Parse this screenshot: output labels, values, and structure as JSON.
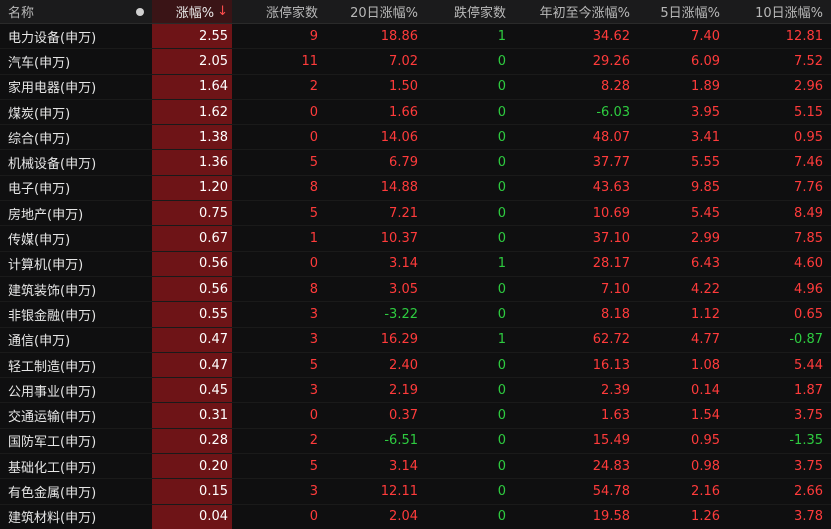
{
  "header": {
    "name": "名称",
    "change": "涨幅%",
    "limit_up": "涨停家数",
    "change_20d": "20日涨幅%",
    "limit_down": "跌停家数",
    "ytd": "年初至今涨幅%",
    "change_5d": "5日涨幅%",
    "change_10d": "10日涨幅%"
  },
  "colors": {
    "up": "#ff3b3b",
    "down": "#2ecc40",
    "highlight": "#6e1417"
  },
  "rows": [
    {
      "name": "电力设备(申万)",
      "change": "2.55",
      "limit_up": "9",
      "change_20d": "18.86",
      "limit_down": "1",
      "ytd": "34.62",
      "change_5d": "7.40",
      "change_10d": "12.81"
    },
    {
      "name": "汽车(申万)",
      "change": "2.05",
      "limit_up": "11",
      "change_20d": "7.02",
      "limit_down": "0",
      "ytd": "29.26",
      "change_5d": "6.09",
      "change_10d": "7.52"
    },
    {
      "name": "家用电器(申万)",
      "change": "1.64",
      "limit_up": "2",
      "change_20d": "1.50",
      "limit_down": "0",
      "ytd": "8.28",
      "change_5d": "1.89",
      "change_10d": "2.96"
    },
    {
      "name": "煤炭(申万)",
      "change": "1.62",
      "limit_up": "0",
      "change_20d": "1.66",
      "limit_down": "0",
      "ytd": "-6.03",
      "change_5d": "3.95",
      "change_10d": "5.15"
    },
    {
      "name": "综合(申万)",
      "change": "1.38",
      "limit_up": "0",
      "change_20d": "14.06",
      "limit_down": "0",
      "ytd": "48.07",
      "change_5d": "3.41",
      "change_10d": "0.95"
    },
    {
      "name": "机械设备(申万)",
      "change": "1.36",
      "limit_up": "5",
      "change_20d": "6.79",
      "limit_down": "0",
      "ytd": "37.77",
      "change_5d": "5.55",
      "change_10d": "7.46"
    },
    {
      "name": "电子(申万)",
      "change": "1.20",
      "limit_up": "8",
      "change_20d": "14.88",
      "limit_down": "0",
      "ytd": "43.63",
      "change_5d": "9.85",
      "change_10d": "7.76"
    },
    {
      "name": "房地产(申万)",
      "change": "0.75",
      "limit_up": "5",
      "change_20d": "7.21",
      "limit_down": "0",
      "ytd": "10.69",
      "change_5d": "5.45",
      "change_10d": "8.49"
    },
    {
      "name": "传媒(申万)",
      "change": "0.67",
      "limit_up": "1",
      "change_20d": "10.37",
      "limit_down": "0",
      "ytd": "37.10",
      "change_5d": "2.99",
      "change_10d": "7.85"
    },
    {
      "name": "计算机(申万)",
      "change": "0.56",
      "limit_up": "0",
      "change_20d": "3.14",
      "limit_down": "1",
      "ytd": "28.17",
      "change_5d": "6.43",
      "change_10d": "4.60"
    },
    {
      "name": "建筑装饰(申万)",
      "change": "0.56",
      "limit_up": "8",
      "change_20d": "3.05",
      "limit_down": "0",
      "ytd": "7.10",
      "change_5d": "4.22",
      "change_10d": "4.96"
    },
    {
      "name": "非银金融(申万)",
      "change": "0.55",
      "limit_up": "3",
      "change_20d": "-3.22",
      "limit_down": "0",
      "ytd": "8.18",
      "change_5d": "1.12",
      "change_10d": "0.65"
    },
    {
      "name": "通信(申万)",
      "change": "0.47",
      "limit_up": "3",
      "change_20d": "16.29",
      "limit_down": "1",
      "ytd": "62.72",
      "change_5d": "4.77",
      "change_10d": "-0.87"
    },
    {
      "name": "轻工制造(申万)",
      "change": "0.47",
      "limit_up": "5",
      "change_20d": "2.40",
      "limit_down": "0",
      "ytd": "16.13",
      "change_5d": "1.08",
      "change_10d": "5.44"
    },
    {
      "name": "公用事业(申万)",
      "change": "0.45",
      "limit_up": "3",
      "change_20d": "2.19",
      "limit_down": "0",
      "ytd": "2.39",
      "change_5d": "0.14",
      "change_10d": "1.87"
    },
    {
      "name": "交通运输(申万)",
      "change": "0.31",
      "limit_up": "0",
      "change_20d": "0.37",
      "limit_down": "0",
      "ytd": "1.63",
      "change_5d": "1.54",
      "change_10d": "3.75"
    },
    {
      "name": "国防军工(申万)",
      "change": "0.28",
      "limit_up": "2",
      "change_20d": "-6.51",
      "limit_down": "0",
      "ytd": "15.49",
      "change_5d": "0.95",
      "change_10d": "-1.35"
    },
    {
      "name": "基础化工(申万)",
      "change": "0.20",
      "limit_up": "5",
      "change_20d": "3.14",
      "limit_down": "0",
      "ytd": "24.83",
      "change_5d": "0.98",
      "change_10d": "3.75"
    },
    {
      "name": "有色金属(申万)",
      "change": "0.15",
      "limit_up": "3",
      "change_20d": "12.11",
      "limit_down": "0",
      "ytd": "54.78",
      "change_5d": "2.16",
      "change_10d": "2.66"
    },
    {
      "name": "建筑材料(申万)",
      "change": "0.04",
      "limit_up": "0",
      "change_20d": "2.04",
      "limit_down": "0",
      "ytd": "19.58",
      "change_5d": "1.26",
      "change_10d": "3.78"
    }
  ]
}
